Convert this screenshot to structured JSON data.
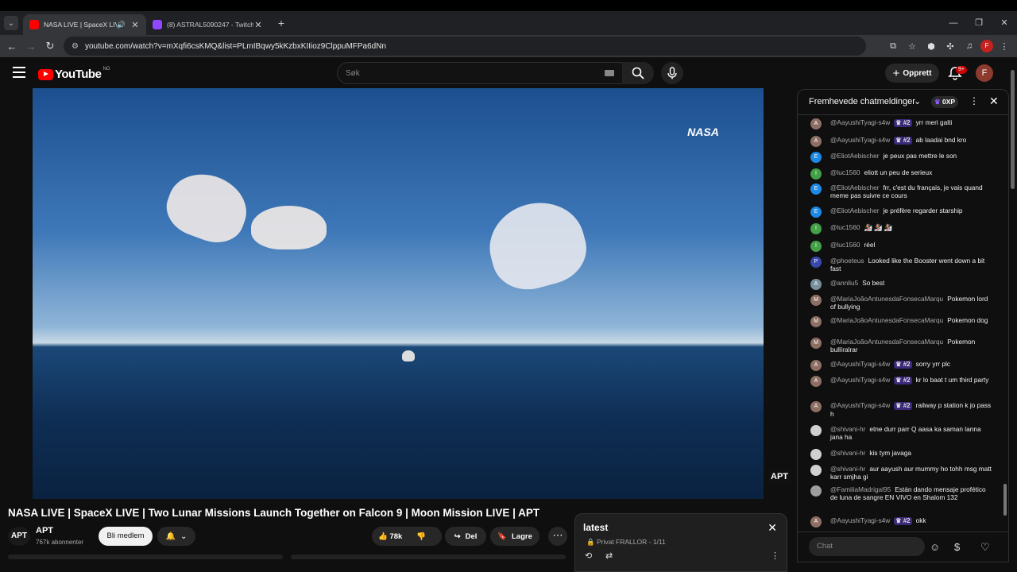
{
  "browser": {
    "tabs": [
      {
        "title": "NASA LIVE | SpaceX LIVE | T",
        "active": true
      },
      {
        "title": "(8) ASTRAL5090247 - Twitch",
        "active": false
      }
    ],
    "new_tab": "+",
    "url": "youtube.com/watch?v=mXqfi6csKMQ&list=PLmIBqwy5kKzbxKIIioz9ClppuMFPa6dNn",
    "window_controls": [
      "—",
      "❐",
      "✕"
    ]
  },
  "youtube": {
    "logo_text": "YouTube",
    "country_code": "NO",
    "search_placeholder": "Søk",
    "create_label": "Opprett",
    "notif_count": "9+",
    "avatar_letter": "F"
  },
  "video": {
    "title": "NASA LIVE | SpaceX LIVE | Two Lunar Missions Launch Together on Falcon 9 | Moon Mission LIVE | APT",
    "overlay_logo": "NASA",
    "watermark": "APT",
    "channel": {
      "avatar_text": "APT",
      "name": "APT",
      "subs": "767k abonnenter"
    },
    "member_label": "Bli medlem",
    "likes": "78k",
    "share_label": "Del",
    "save_label": "Lagre"
  },
  "playlist": {
    "title": "latest",
    "subtitle": "Privat FRALLOR - 1/11"
  },
  "chat": {
    "header": "Fremhevede chatmeldinger",
    "xp_label": "0XP",
    "input_placeholder": "Chat",
    "messages": [
      {
        "av": "A",
        "color": "#8d6e63",
        "author": "@AayushiTyagi-s4w",
        "rank": "#2",
        "text": "yrr meri galti"
      },
      {
        "av": "A",
        "color": "#8d6e63",
        "author": "@AayushiTyagi-s4w",
        "rank": "#2",
        "text": "ab laadai bnd kro"
      },
      {
        "av": "E",
        "color": "#1e88e5",
        "author": "@EliotAebischer",
        "rank": "",
        "text": "je peux pas mettre le son"
      },
      {
        "av": "I",
        "color": "#43a047",
        "author": "@luc1560",
        "rank": "",
        "text": "eliott un peu de serieux"
      },
      {
        "av": "E",
        "color": "#1e88e5",
        "author": "@EliotAebischer",
        "rank": "",
        "text": "frr, c'est du français, je vais quand meme pas suivre ce cours"
      },
      {
        "av": "E",
        "color": "#1e88e5",
        "author": "@EliotAebischer",
        "rank": "",
        "text": "je préfère regarder starship"
      },
      {
        "av": "I",
        "color": "#43a047",
        "author": "@luc1560",
        "rank": "",
        "text": "🏂 🏂 🏂"
      },
      {
        "av": "I",
        "color": "#43a047",
        "author": "@luc1560",
        "rank": "",
        "text": "réel"
      },
      {
        "av": "P",
        "color": "#3949ab",
        "author": "@phoeteus",
        "rank": "",
        "text": "Looked like the Booster went down a bit fast"
      },
      {
        "av": "A",
        "color": "#78909c",
        "author": "@annliu5",
        "rank": "",
        "text": "So best"
      },
      {
        "av": "M",
        "color": "#8d6e63",
        "author": "@MariaJoãoAntunesdaFonsecaMarqu",
        "rank": "",
        "text": "Pokemon lord of bullying"
      },
      {
        "av": "M",
        "color": "#8d6e63",
        "author": "@MariaJoãoAntunesdaFonsecaMarqu",
        "rank": "",
        "text": "Pokemon dog"
      },
      {
        "av": "M",
        "color": "#8d6e63",
        "author": "@MariaJoãoAntunesdaFonsecaMarqu",
        "rank": "",
        "text": "Pokemon bullíralrar"
      },
      {
        "av": "A",
        "color": "#8d6e63",
        "author": "@AayushiTyagi-s4w",
        "rank": "#2",
        "text": "sorry yrr plc"
      },
      {
        "av": "A",
        "color": "#8d6e63",
        "author": "@AayushiTyagi-s4w",
        "rank": "#2",
        "text": "kr lo baat t um third party"
      },
      {
        "av": "A",
        "color": "#8d6e63",
        "author": "@AayushiTyagi-s4w",
        "rank": "#2",
        "text": "railway p station k jo pass h"
      },
      {
        "av": "",
        "color": "#d0d0d0",
        "author": "@shivani-hr",
        "rank": "",
        "text": "etne durr parr Q aasa ka saman lanna jana ha"
      },
      {
        "av": "",
        "color": "#d0d0d0",
        "author": "@shivani-hr",
        "rank": "",
        "text": "kis tym javaga"
      },
      {
        "av": "",
        "color": "#d0d0d0",
        "author": "@shivani-hr",
        "rank": "",
        "text": "aur aayush aur mummy ho tohh msg matt karr smjha gi"
      },
      {
        "av": "",
        "color": "#9e9e9e",
        "author": "@FamiliaMadrigal95",
        "rank": "",
        "text": "Están dando mensaje profético de luna de sangre EN VIVO en Shalom 132"
      },
      {
        "av": "A",
        "color": "#8d6e63",
        "author": "@AayushiTyagi-s4w",
        "rank": "#2",
        "text": "okk"
      }
    ]
  }
}
